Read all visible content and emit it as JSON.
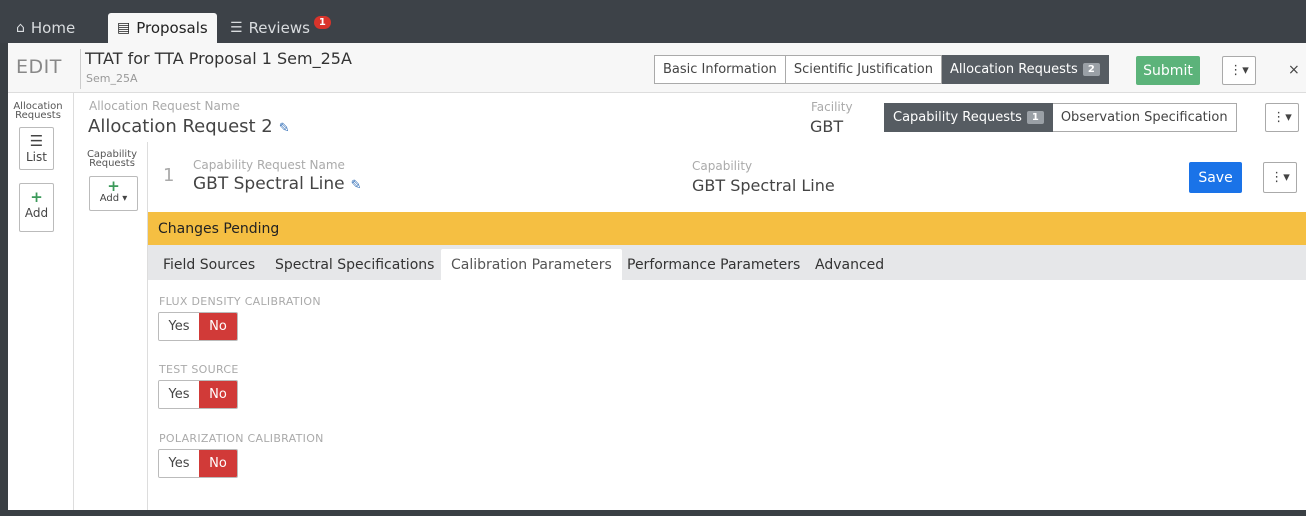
{
  "topnav": {
    "home": "Home",
    "proposals": "Proposals",
    "reviews": "Reviews",
    "reviews_badge": "1"
  },
  "proposal": {
    "mode": "EDIT",
    "title": "TTAT for TTA Proposal 1 Sem_25A",
    "subtitle": "Sem_25A",
    "tabs": [
      "Basic Information",
      "Scientific Justification",
      "Allocation Requests"
    ],
    "allocation_badge": "2",
    "submit_label": "Submit",
    "close_label": "×"
  },
  "alloc_sidebar": {
    "caption_line1": "Allocation",
    "caption_line2": "Requests",
    "list_label": "List",
    "add_label": "Add"
  },
  "allocation_request": {
    "name_label": "Allocation Request Name",
    "name_value": "Allocation Request 2",
    "facility_label": "Facility",
    "facility_value": "GBT",
    "tabs": [
      "Capability Requests",
      "Observation Specification"
    ],
    "capability_badge": "1"
  },
  "cap_sidebar": {
    "caption_line1": "Capability",
    "caption_line2": "Requests",
    "add_label": "Add"
  },
  "capability_request": {
    "index": "1",
    "name_label": "Capability Request Name",
    "name_value": "GBT Spectral Line",
    "capability_label": "Capability",
    "capability_value": "GBT Spectral Line",
    "save_label": "Save"
  },
  "pending_banner": "Changes Pending",
  "section_tabs": [
    "Field Sources",
    "Spectral Specifications",
    "Calibration Parameters",
    "Performance Parameters",
    "Advanced"
  ],
  "active_tab": "Calibration Parameters",
  "parameters": [
    {
      "label": "FLUX DENSITY CALIBRATION",
      "yes": "Yes",
      "no": "No",
      "selected": "No"
    },
    {
      "label": "TEST SOURCE",
      "yes": "Yes",
      "no": "No",
      "selected": "No"
    },
    {
      "label": "POLARIZATION CALIBRATION",
      "yes": "Yes",
      "no": "No",
      "selected": "No"
    }
  ],
  "colors": {
    "active_no": "#d13a38",
    "pending": "#f5bf42",
    "save": "#1a73e8",
    "submit": "#5cb37a",
    "nav_bg": "#3d4248"
  }
}
